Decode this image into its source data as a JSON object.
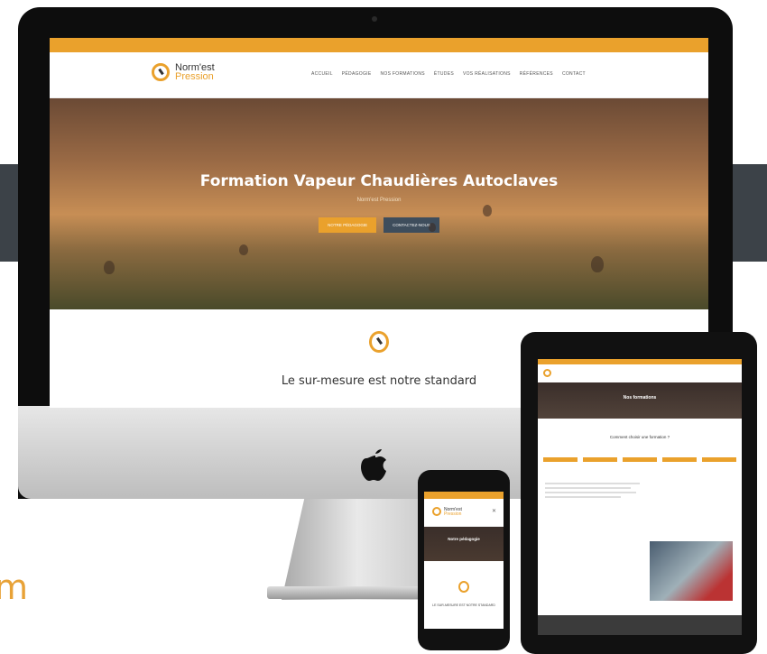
{
  "colors": {
    "accent": "#eaa12c",
    "dark_band": "#3c4248",
    "button_secondary": "#3e4d5c"
  },
  "side_text": "m",
  "site": {
    "topbar_text": "",
    "logo": {
      "line1": "Norm'est",
      "line2": "Pression"
    },
    "menu": [
      "ACCUEIL",
      "PÉDAGOGIE",
      "NOS FORMATIONS",
      "ÉTUDES",
      "VOS RÉALISATIONS",
      "RÉFÉRENCES",
      "CONTACT"
    ],
    "hero": {
      "title": "Formation Vapeur Chaudières Autoclaves",
      "subtitle": "Norm'est Pression",
      "button_primary": "NOTRE PÉDAGOGIE",
      "button_secondary": "CONTACTEZ-NOUS"
    },
    "tagline": "Le sur-mesure est notre standard"
  },
  "tablet": {
    "hero_title": "Nos formations",
    "question": "Comment choisir une formation ?"
  },
  "phone": {
    "hero_title": "Notre pédagogie",
    "tagline": "LE SUR-MESURE EST NOTRE STANDARD"
  },
  "icons": [
    "apple-logo-icon",
    "compass-pin-icon",
    "close-icon"
  ]
}
